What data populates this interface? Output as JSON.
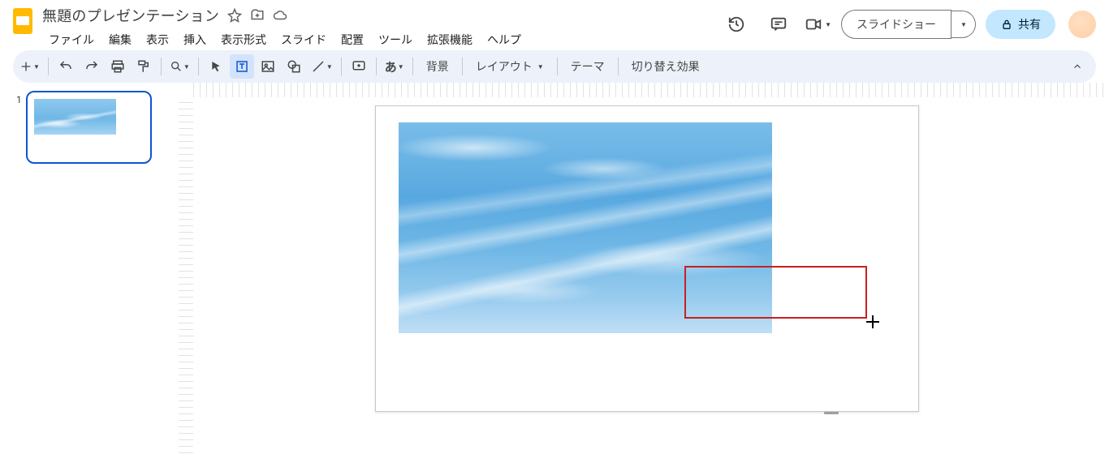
{
  "header": {
    "doc_title": "無題のプレゼンテーション",
    "slideshow_label": "スライドショー",
    "share_label": "共有"
  },
  "menus": {
    "file": "ファイル",
    "edit": "編集",
    "view": "表示",
    "insert": "挿入",
    "format": "表示形式",
    "slide": "スライド",
    "arrange": "配置",
    "tools": "ツール",
    "extensions": "拡張機能",
    "help": "ヘルプ"
  },
  "toolbar": {
    "background": "背景",
    "layout": "レイアウト",
    "theme": "テーマ",
    "transition": "切り替え効果",
    "input_kana": "あ"
  },
  "filmstrip": {
    "slides": [
      {
        "number": "1"
      }
    ]
  }
}
